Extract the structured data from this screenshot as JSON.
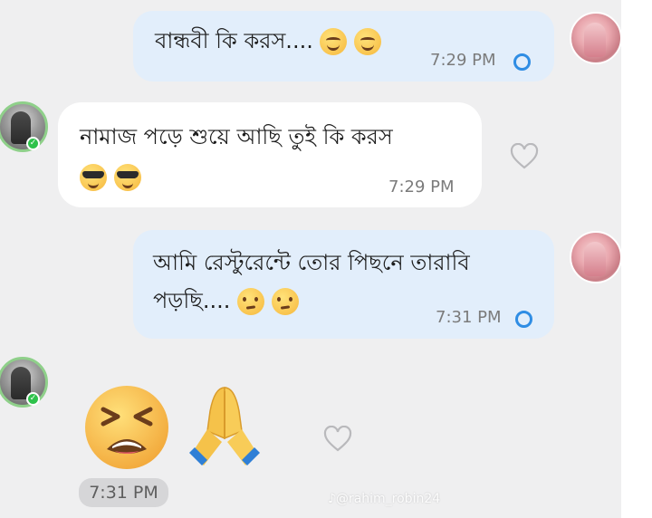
{
  "messages": [
    {
      "direction": "outgoing",
      "text": "বান্ধবী কি করস....",
      "emojis": [
        "smiling-face-icon",
        "smiling-face-icon"
      ],
      "time": "7:29 PM",
      "status": "sent"
    },
    {
      "direction": "incoming",
      "text_line1": "নামাজ পড়ে শুয়ে আছি তুই কি করস",
      "emojis": [
        "sunglasses-face-icon",
        "sunglasses-face-icon"
      ],
      "time": "7:29 PM"
    },
    {
      "direction": "outgoing",
      "text_line1": "আমি রেস্টুরেন্টে  তোর পিছনে তারাবি",
      "text_line2": "পড়ছি....",
      "emojis": [
        "face-with-raised-eyebrow-icon",
        "face-with-raised-eyebrow-icon"
      ],
      "time": "7:31 PM",
      "status": "sent"
    },
    {
      "direction": "incoming",
      "emojis": [
        "tired-face-icon",
        "folded-hands-icon"
      ],
      "time": "7:31 PM"
    }
  ],
  "watermark": "♪@rahim_robin24",
  "colors": {
    "background": "#efeff0",
    "outgoing_bubble": "#e2eefb",
    "incoming_bubble": "#ffffff",
    "status_ring": "#2f8de4",
    "online": "#2ec24b"
  }
}
